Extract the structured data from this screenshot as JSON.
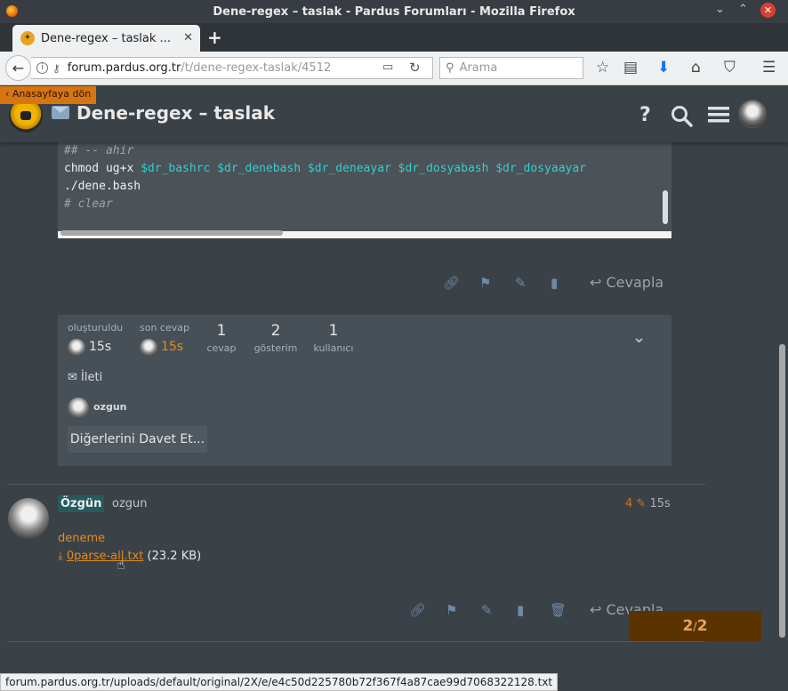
{
  "window": {
    "title": "Dene-regex – taslak - Pardus Forumları - Mozilla Firefox"
  },
  "tab": {
    "title": "Dene-regex – taslak ..."
  },
  "navbar": {
    "url_domain": "forum.pardus.org.tr",
    "url_path": "/t/dene-regex-taslak/4512",
    "search_placeholder": "Arama"
  },
  "site": {
    "back_home": "Anasayfaya dön",
    "topic_title": "Dene-regex – taslak"
  },
  "code": {
    "lines": [
      {
        "comment": "## -- ahir"
      },
      {
        "cmd": "chmod ug+x ",
        "vars": "$dr_bashrc $dr_denebash $dr_deneayar $dr_dosyabash $dr_dosyaayar"
      },
      {
        "cmd": "./dene.bash"
      },
      {
        "comment": "# clear"
      }
    ]
  },
  "post_actions": {
    "reply_label": "Cevapla"
  },
  "topic_map": {
    "created_label": "oluşturuldu",
    "created_time": "15s",
    "last_reply_label": "son cevap",
    "last_reply_time": "15s",
    "stats": [
      {
        "value": "1",
        "label": "cevap"
      },
      {
        "value": "2",
        "label": "gösterim"
      },
      {
        "value": "1",
        "label": "kullanıcı"
      }
    ],
    "message_label": "İleti",
    "participant": "ozgun",
    "invite_label": "Diğerlerini Davet Et..."
  },
  "post": {
    "display_name": "Özgün",
    "username": "ozgun",
    "edit_count": "4",
    "time": "15s",
    "body_text": "deneme",
    "attachment_name": "0parse-all.txt",
    "attachment_size": "(23.2 KB)",
    "reply_label": "Cevapla"
  },
  "progress": {
    "current": "2",
    "separator": "/",
    "total": "2"
  },
  "status_bar": {
    "url": "forum.pardus.org.tr/uploads/default/original/2X/e/e4c50d225780b72f367f4a87cae99d7068322128.txt"
  },
  "colors": {
    "accent": "#e28a1c",
    "background": "#3a4147",
    "name_badge": "#275a5a"
  }
}
